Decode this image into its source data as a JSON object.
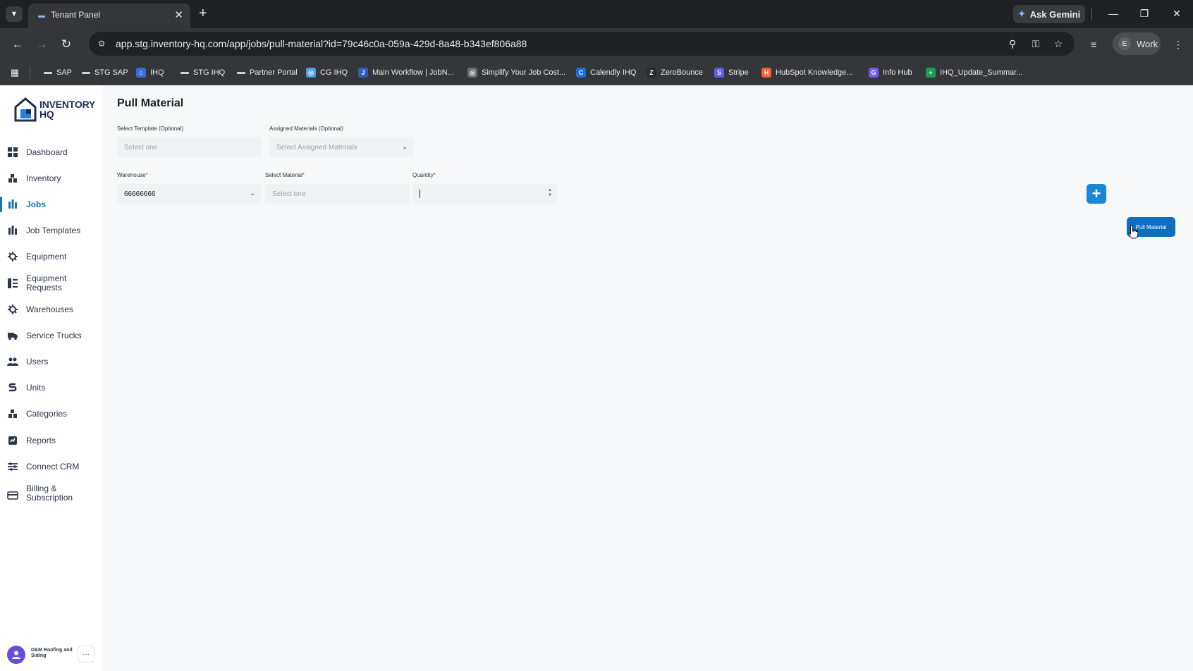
{
  "browser": {
    "tab_title": "Tenant Panel",
    "tab_close": "✕",
    "new_tab": "+",
    "ask_gemini": "Ask Gemini",
    "url": "app.stg.inventory-hq.com/app/jobs/pull-material?id=79c46c0a-059a-429d-8a48-b343ef806a88",
    "profile_initial": "E",
    "profile_label": "Work",
    "bookmarks": [
      {
        "label": "SAP",
        "icon": "dash-icon",
        "color": "#cfd3d8"
      },
      {
        "label": "STG SAP",
        "icon": "dash-icon",
        "color": "#cfd3d8"
      },
      {
        "label": "IHQ",
        "icon": "house-icon",
        "color": "#3b6fd6"
      },
      {
        "label": "STG IHQ",
        "icon": "dash-icon",
        "color": "#cfd3d8"
      },
      {
        "label": "Partner Portal",
        "icon": "dash-icon",
        "color": "#cfd3d8"
      },
      {
        "label": "CG IHQ",
        "icon": "globe-icon",
        "color": "#4aa3e8"
      },
      {
        "label": "Main Workflow | JobN...",
        "icon": "jobnimbus-icon",
        "color": "#2d5bc8"
      },
      {
        "label": "Simplify Your Job Cost...",
        "icon": "globe-icon",
        "color": "#6b7075"
      },
      {
        "label": "Calendly IHQ",
        "icon": "calendly-icon",
        "color": "#1a6fe0"
      },
      {
        "label": "ZeroBounce",
        "icon": "zerobounce-icon",
        "color": "#2b2b2b"
      },
      {
        "label": "Stripe",
        "icon": "stripe-icon",
        "color": "#635bff"
      },
      {
        "label": "HubSpot Knowledge...",
        "icon": "hubspot-icon",
        "color": "#ff5c35"
      },
      {
        "label": "Info Hub",
        "icon": "infohub-icon",
        "color": "#7a5af5"
      },
      {
        "label": "IHQ_Update_Summar...",
        "icon": "sheets-icon",
        "color": "#1e9e54"
      }
    ]
  },
  "app": {
    "logo_text": "INVENTORY HQ",
    "accent_color": "#1a73b8",
    "sidebar": [
      {
        "label": "Dashboard",
        "icon": "dashboard-icon"
      },
      {
        "label": "Inventory",
        "icon": "inventory-icon"
      },
      {
        "label": "Jobs",
        "icon": "jobs-icon",
        "active": true
      },
      {
        "label": "Job Templates",
        "icon": "job-templates-icon"
      },
      {
        "label": "Equipment",
        "icon": "equipment-icon"
      },
      {
        "label": "Equipment Requests",
        "icon": "equipment-requests-icon"
      },
      {
        "label": "Warehouses",
        "icon": "warehouses-icon"
      },
      {
        "label": "Service Trucks",
        "icon": "truck-icon"
      },
      {
        "label": "Users",
        "icon": "users-icon"
      },
      {
        "label": "Units",
        "icon": "units-icon"
      },
      {
        "label": "Categories",
        "icon": "categories-icon"
      },
      {
        "label": "Reports",
        "icon": "reports-icon"
      },
      {
        "label": "Connect CRM",
        "icon": "crm-icon"
      },
      {
        "label": "Billing & Subscription",
        "icon": "billing-icon"
      }
    ],
    "user": {
      "name": "D&M Roofing and Siding",
      "more": "···"
    },
    "page_title": "Pull Material",
    "form": {
      "template_label": "Select Template (Optional)",
      "template_placeholder": "Select one",
      "assigned_label": "Assigned Materials (Optional)",
      "assigned_placeholder": "Select Assigned Materials",
      "warehouse_label": "Warehouse",
      "warehouse_value": "66666666",
      "material_label": "Select Material",
      "material_placeholder": "Select one",
      "quantity_label": "Quantity",
      "quantity_value": "",
      "required_mark": "*"
    },
    "add_button": "+",
    "pull_button": "Pull Material"
  }
}
